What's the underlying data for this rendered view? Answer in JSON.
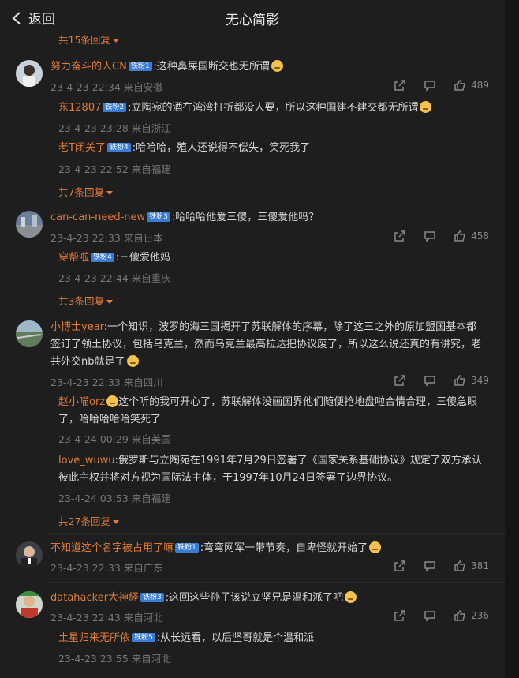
{
  "header": {
    "back_label": "返回",
    "title": "无心简影"
  },
  "top_expand": "共15条回复",
  "comments": [
    {
      "user": "努力奋斗的人CN",
      "badge": "铁粉1",
      "text": ":这种鼻屎国断交也无所谓",
      "time": "23-4-23 22:34 来自安徽",
      "likes": "489",
      "replies": [
        {
          "user": "东12807",
          "badge": "铁粉2",
          "text": ":立陶宛的酒在湾湾打折都没人要，所以这种国建不建交都无所谓",
          "time": "23-4-23 23:28 来自浙江"
        },
        {
          "user": "老T闭关了",
          "badge": "铁粉4",
          "text": ":哈哈哈，殖人还说得不偿失，笑死我了",
          "time": "23-4-23 22:52 来自福建"
        }
      ],
      "expand": "共7条回复"
    },
    {
      "user": "can-can-need-new",
      "badge": "铁粉3",
      "text": ":哈哈哈他爱三傻，三傻爱他吗？",
      "time": "23-4-23 22:33 来自日本",
      "likes": "458",
      "replies": [
        {
          "user": "穿帮啦",
          "badge": "铁粉4",
          "text": ":三傻爱他妈",
          "time": "23-4-23 22:44 来自重庆"
        }
      ],
      "expand": "共3条回复"
    },
    {
      "user": "小博士year",
      "badge": "",
      "text": ":一个知识，波罗的海三国揭开了苏联解体的序幕，除了这三之外的原加盟国基本都签订了领土协议，包括乌克兰，然而乌克兰最高拉达把协议废了，所以这么说还真的有讲究，老共外交nb就是了",
      "time": "23-4-23 22:33 来自四川",
      "likes": "349",
      "replies": [
        {
          "user": "赵小喵orz",
          "badge": "",
          "text": "这个听的我可开心了，苏联解体没画国界他们随便抢地盘啦合情合理，三傻急眼了，哈哈哈哈哈笑死了",
          "time": "23-4-24 00:29 来自美国"
        },
        {
          "user": "love_wuwu",
          "badge": "",
          "text": ":俄罗斯与立陶宛在1991年7月29日签署了《国家关系基础协议》规定了双方承认彼此主权并将对方视为国际法主体，于1997年10月24日签署了边界协议。",
          "time": "23-4-24 03:53 来自福建"
        }
      ],
      "expand": "共27条回复"
    },
    {
      "user": "不知道这个名字被占用了嘛",
      "badge": "铁粉1",
      "text": ":弯弯网军一带节奏，自卑怪就开始了",
      "time": "23-4-23 22:33 来自广东",
      "likes": "381",
      "replies": [],
      "expand": ""
    },
    {
      "user": "datahacker大神経",
      "badge": "铁粉3",
      "text": ":这回这些孙子该说立坚兄是温和派了吧",
      "time": "23-4-23 22:43 来自河北",
      "likes": "236",
      "replies": [
        {
          "user": "土星归来无所依",
          "badge": "铁粉5",
          "text": ":从长远看，以后坚哥就是个温和派",
          "time": "23-4-23 23:55 来自河北"
        }
      ],
      "expand": ""
    }
  ],
  "colors": {
    "accent": "#e07b39",
    "badge": "#3a7bd5",
    "bg": "#1e1e1e"
  },
  "icons": [
    "share-icon",
    "comment-icon",
    "like-icon",
    "back-chevron-icon"
  ]
}
